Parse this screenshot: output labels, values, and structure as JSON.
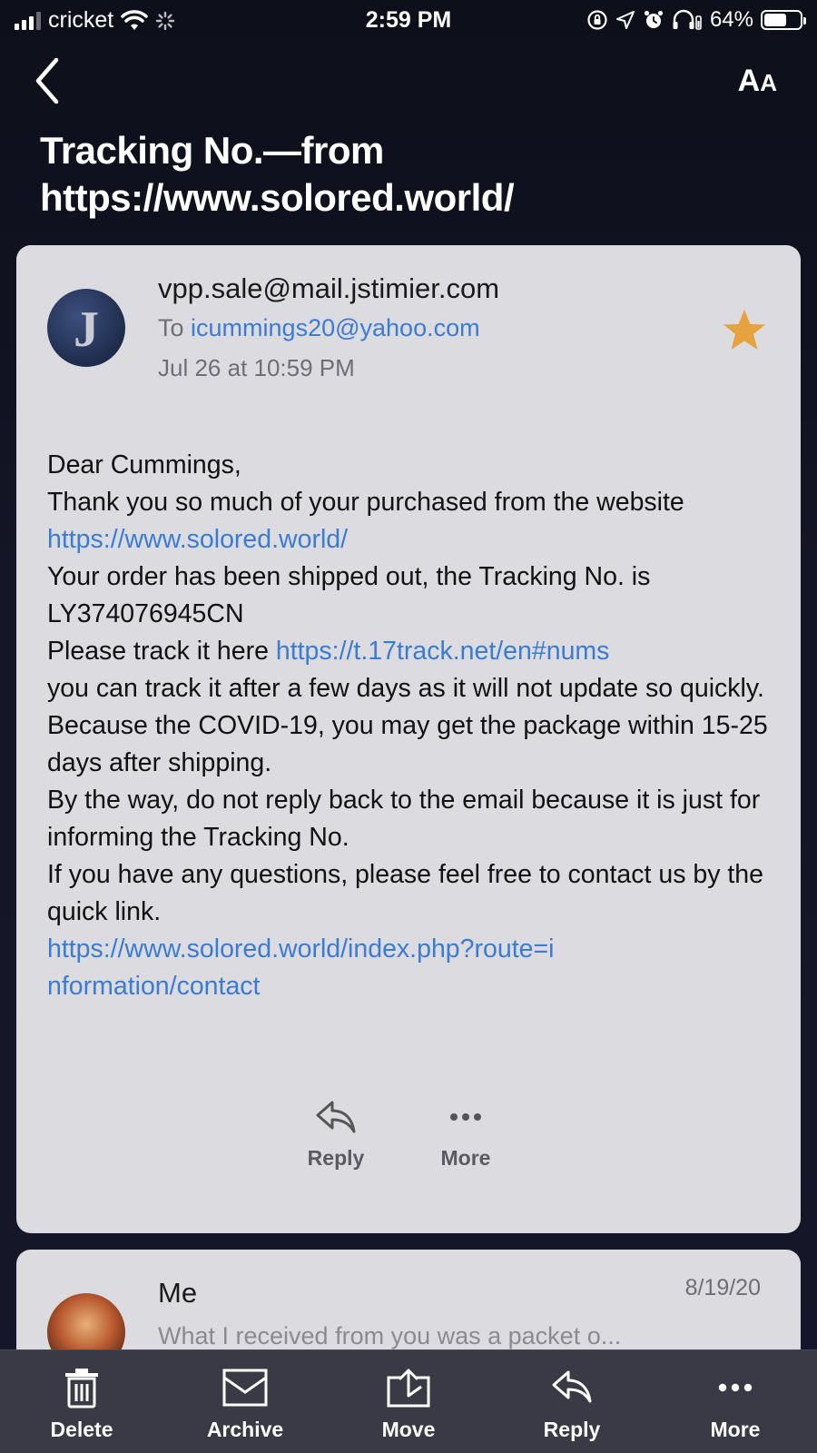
{
  "status_bar": {
    "carrier": "cricket",
    "time": "2:59 PM",
    "battery_percent": "64%",
    "battery_level": 0.64
  },
  "nav": {
    "back_icon": "chevron-left-icon",
    "text_size_label_big": "A",
    "text_size_label_small": "A"
  },
  "message": {
    "subject": "Tracking No.—from https://www.solored.world/",
    "from": "vpp.sale@mail.jstimier.com",
    "avatar_letter": "J",
    "to_prefix": "To",
    "to_address": "icummings20@yahoo.com",
    "date": "Jul 26 at 10:59 PM",
    "starred": true,
    "star_color": "#e6a23c",
    "body": {
      "greeting": "Dear Cummings,",
      "line1_text": "Thank you so much of your purchased from the website",
      "line1_link": "https://www.solored.world/",
      "line2": "Your order has been shipped out, the Tracking No. is LY374076945CN",
      "line3_text": "Please track it here",
      "line3_link": "https://t.17track.net/en#nums",
      "line4": "you can track it after a few days as it will not update so quickly.",
      "line5": "Because the COVID-19, you may get the package within 15-25 days after shipping.",
      "line6": "By the way, do not reply back to the email because it is just for informing the Tracking No.",
      "line7": "If you have any questions, please feel free to contact us by the quick link.",
      "contact_link": "https://www.solored.world/index.php?route=information/contact"
    },
    "actions": {
      "reply": "Reply",
      "more": "More"
    }
  },
  "thread_next": {
    "sender": "Me",
    "date": "8/19/20",
    "preview": "What I received from you was a packet o..."
  },
  "toolbar": {
    "delete": "Delete",
    "archive": "Archive",
    "move": "Move",
    "reply": "Reply",
    "more": "More"
  },
  "colors": {
    "link": "#3a7bd5",
    "card_bg": "#dcdce0",
    "toolbar_bg": "#3a3a46"
  }
}
